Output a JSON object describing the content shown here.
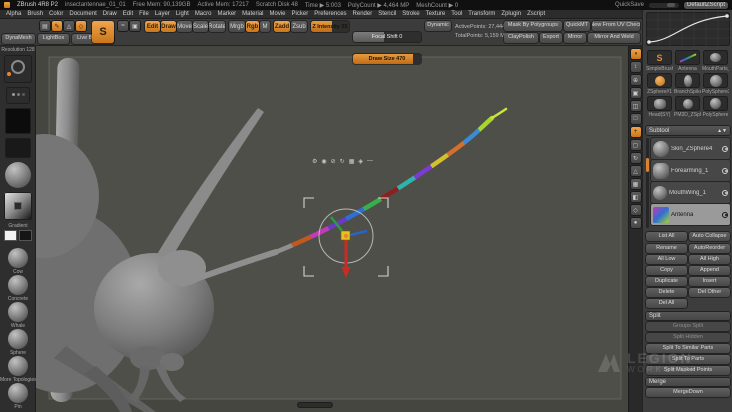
{
  "theme": {
    "accent": "#d9832e",
    "canvas_bg": "#4e4f48",
    "selected_gray": "#9a9a9a"
  },
  "titlebar": {
    "app_title": "ZBrush 4R8 P2",
    "doc_name": "insectantennae_01_01",
    "stats": [
      "Free Mem: 90,139GB",
      "Active Mem: 17217",
      "Scratch Disk 48",
      "Time ▶ 5:003",
      "PolyCount ▶ 4,464 MP",
      "MeshCount ▶ 0"
    ],
    "quicksave_label": "QuickSave",
    "zscript_label": "DefaultZScript"
  },
  "menubar": {
    "items": [
      "Alpha",
      "Brush",
      "Color",
      "Document",
      "Draw",
      "Edit",
      "File",
      "Layer",
      "Light",
      "Macro",
      "Marker",
      "Material",
      "Movie",
      "Picker",
      "Preferences",
      "Render",
      "Stencil",
      "Stroke",
      "Texture",
      "Tool",
      "Transform",
      "Zplugin",
      "Zscript"
    ]
  },
  "shelf": {
    "dynamesh": "DynaMesh",
    "lightbox": "LightBox",
    "live_boolean": "Live Boolean",
    "brush_initial": "S",
    "modes": [
      "Edit",
      "Draw",
      "Move",
      "Scale",
      "Rotate"
    ],
    "paint": [
      "Mrgb",
      "Rgb",
      "M"
    ],
    "sculpt": [
      "Zadd",
      "Zsub"
    ],
    "z_intensity": "Z Intensity 25",
    "focal_shift": "Focal Shift 0",
    "draw_size": "Draw Size 470",
    "dynamic": "Dynamic",
    "active_points": "ActivePoints: 27,444",
    "total_points": "TotalPoints: 5,159 MX",
    "mask_by_polygroups": "Mask By Polygroups",
    "quickmt": "QuickMT",
    "new_from_uv_check": "New From UV Check",
    "claypolish": "ClayPolish",
    "export": "Export",
    "mirror": "Mirror",
    "mirror_and_weld": "Mirror And Weld"
  },
  "left_tray": {
    "resolution": "Resolution 128",
    "gradient_label": "Gradient",
    "material_labels": [
      "Cow",
      "Concrete",
      "Whale",
      "Sphere",
      "More Topologies",
      "Pin"
    ]
  },
  "canvas": {
    "gizmo_icons": [
      "⚙",
      "◉",
      "⊘",
      "↻",
      "▦",
      "◈",
      "—"
    ],
    "antenna_colors": [
      "#8f8f8f",
      "#c2581f",
      "#c23ab5",
      "#6a3ac2",
      "#2f6fd4",
      "#36b04c",
      "#8a2121",
      "#2fb3ab",
      "#7a3ad4",
      "#d4c02f",
      "#d4702f",
      "#3a8ad4",
      "#a7d42f"
    ],
    "watermark": {
      "line1": "LEGION",
      "line2": "WORKSHOP"
    }
  },
  "right_shelf": {
    "glyphs": [
      "◑",
      "↕",
      "⊕",
      "▣",
      "◫",
      "□",
      "+",
      "▢",
      "↻",
      "△",
      "▦",
      "◧",
      "◇",
      "●"
    ]
  },
  "right_palette": {
    "tools": [
      "SimpleBrush",
      "Antenna",
      "MouthParts_1",
      "ZSphere#1",
      "BranchSpike_1",
      "PolySphere3D",
      "Head(SY)",
      "PM3D_ZSphere1",
      "PolySphere"
    ],
    "subtool_header": "Subtool",
    "subtools": [
      "Skin_ZSphere4",
      "Forearming_1",
      "MouthWing_1",
      "Antenna"
    ],
    "list_all": "List All",
    "auto_collapse": "Auto Collapse",
    "buttons": [
      [
        "Rename",
        "AutoReorder"
      ],
      [
        "All Low",
        "All High"
      ],
      [
        "Copy",
        "Append"
      ],
      [
        "Duplicate",
        "Insert"
      ],
      [
        "Delete",
        "Del Other"
      ]
    ],
    "del_all": "Del All",
    "split_header": "Split",
    "split_items": [
      "Groups Split",
      "Split Hidden",
      "Split To Similar Parts",
      "Split To Parts",
      "Split Masked Points"
    ],
    "merge_header": "Merge",
    "merge_down": "MergeDown"
  }
}
